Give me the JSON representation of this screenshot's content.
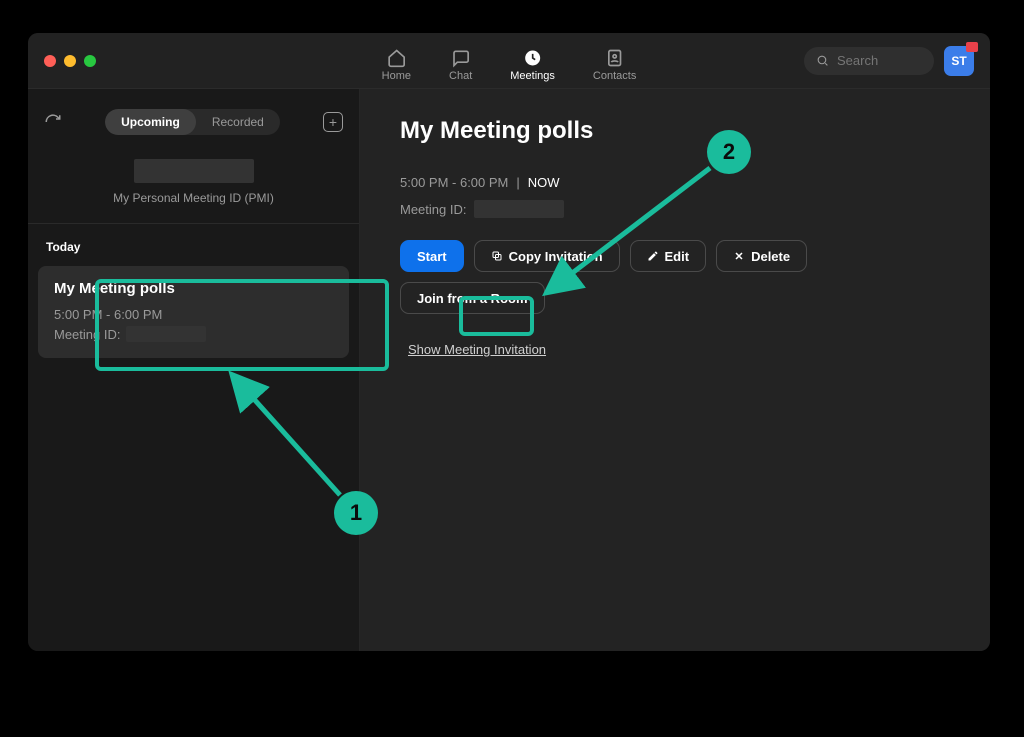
{
  "nav": {
    "home": "Home",
    "chat": "Chat",
    "meetings": "Meetings",
    "contacts": "Contacts"
  },
  "search": {
    "placeholder": "Search"
  },
  "avatar": {
    "initials": "ST"
  },
  "sidebar": {
    "tabs": {
      "upcoming": "Upcoming",
      "recorded": "Recorded"
    },
    "pmi_label": "My Personal Meeting ID (PMI)",
    "section_today": "Today",
    "meeting": {
      "title": "My Meeting polls",
      "time": "5:00 PM - 6:00 PM",
      "id_label": "Meeting ID:"
    }
  },
  "detail": {
    "title": "My Meeting polls",
    "time": "5:00 PM - 6:00 PM",
    "divider": "|",
    "now": "NOW",
    "id_label": "Meeting ID:",
    "buttons": {
      "start": "Start",
      "copy": "Copy Invitation",
      "edit": "Edit",
      "delete": "Delete",
      "join_room": "Join from a Room"
    },
    "show_invite": "Show Meeting Invitation"
  },
  "annotations": {
    "one": "1",
    "two": "2"
  }
}
